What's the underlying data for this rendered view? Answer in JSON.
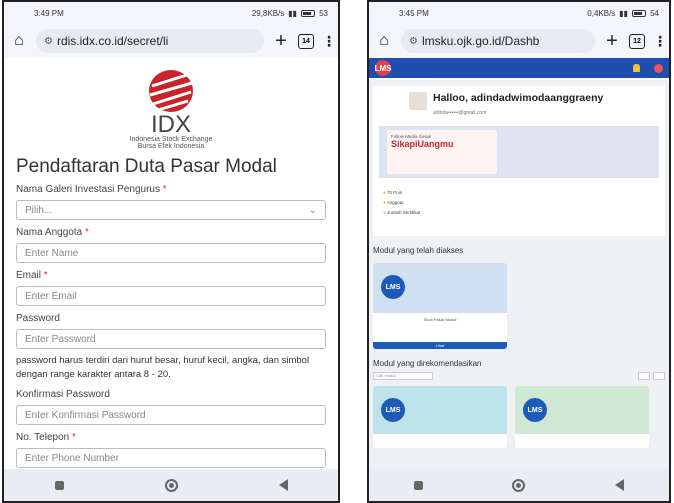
{
  "left_phone": {
    "status": {
      "time": "3:49 PM",
      "net": "29,8KB/s",
      "battery": "53"
    },
    "address": {
      "url": "rdis.idx.co.id/secret/li",
      "tabs_count": "14"
    },
    "brand": {
      "name": "IDX",
      "line1": "Indonesia Stock Exchange",
      "line2": "Bursa Efek Indonesia"
    },
    "form": {
      "title": "Pendaftaran Duta Pasar Modal",
      "galeri_label": "Nama Galeri Investasi Pengurus",
      "galeri_placeholder": "Pilih...",
      "anggota_label": "Nama Anggota",
      "anggota_placeholder": "Enter Name",
      "email_label": "Email",
      "email_placeholder": "Enter Email",
      "password_label": "Password",
      "password_placeholder": "Enter Password",
      "password_hint": "password harus terdiri dari huruf besar, huruf kecil, angka, dan simbol dengan range karakter antara 8 - 20.",
      "konfirmasi_label": "Konfirmasi Password",
      "konfirmasi_placeholder": "Enter Konfirmasi Password",
      "telepon_label": "No. Telepon",
      "telepon_placeholder": "Enter Phone Number",
      "required_mark": "*"
    }
  },
  "right_phone": {
    "status": {
      "time": "3:45 PM",
      "net": "0,4KB/s",
      "battery": "54"
    },
    "address": {
      "url": "lmsku.ojk.go.id/Dashb",
      "tabs_count": "12"
    },
    "header": {
      "logo": "LMS"
    },
    "greeting": {
      "text": "Halloo, adindadwimodaanggraeny",
      "email": "adinda••••••@gmail.com"
    },
    "banner": {
      "title": "SikapiUangmu",
      "subtitle": "Follow Media Sosial"
    },
    "stats": [
      "70 Poin",
      "Anggota",
      "Jumlah Sertifikat"
    ],
    "modul_accessed_title": "Modul yang telah diakses",
    "card_badge": "LMS",
    "card_caption": "Studi Pasar Modal",
    "card_button": "Lihat",
    "recommended_title": "Modul yang direkomendasikan",
    "recommended_search_placeholder": "Cari modul"
  }
}
